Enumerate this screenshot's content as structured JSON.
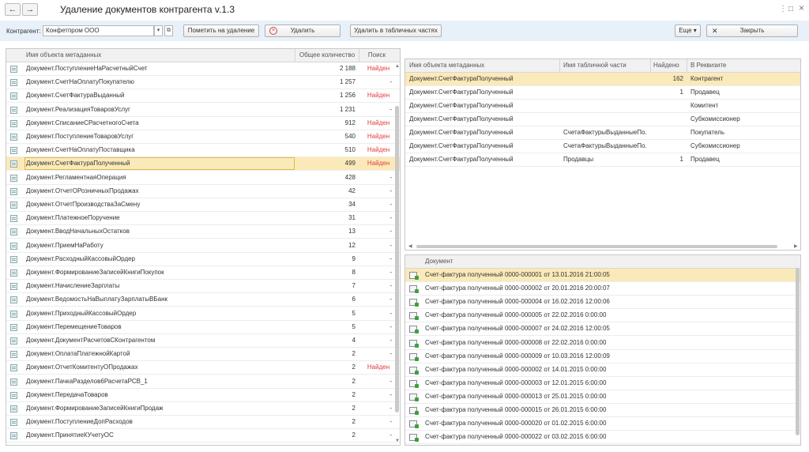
{
  "window": {
    "title": "Удаление документов контрагента v.1.3",
    "back_icon": "←",
    "forward_icon": "→",
    "menu_icon": "⋮",
    "minimize_icon": "□",
    "close_icon": "×"
  },
  "toolbar": {
    "counterparty_label": "Контрагент:",
    "counterparty_value": "Конфетпром ООО",
    "dropdown_icon": "▾",
    "open_icon": "⧉",
    "mark_delete_label": "Пометить на удаление",
    "delete_label": "Удалить",
    "delete_icon": "×",
    "delete_tables_label": "Удалить в табличных частях",
    "more_label": "Еще ▾",
    "close_label": "Закрыть",
    "close_icon": "✕"
  },
  "left_table": {
    "headers": [
      "Имя объекта метаданных",
      "Общее количество",
      "Поиск"
    ],
    "rows": [
      {
        "name": "Документ.ПоступлениеНаРасчетныйСчет",
        "count": "2 188",
        "search": "Найден"
      },
      {
        "name": "Документ.СчетНаОплатуПокупателю",
        "count": "1 257",
        "search": "-"
      },
      {
        "name": "Документ.СчетФактураВыданный",
        "count": "1 256",
        "search": "Найден"
      },
      {
        "name": "Документ.РеализацияТоваровУслуг",
        "count": "1 231",
        "search": "-"
      },
      {
        "name": "Документ.СписаниеСРасчетногоСчета",
        "count": "912",
        "search": "Найден"
      },
      {
        "name": "Документ.ПоступлениеТоваровУслуг",
        "count": "540",
        "search": "Найден"
      },
      {
        "name": "Документ.СчетНаОплатуПоставщика",
        "count": "510",
        "search": "Найден"
      },
      {
        "name": "Документ.СчетФактураПолученный",
        "count": "499",
        "search": "Найден"
      },
      {
        "name": "Документ.РегламентнаяОперация",
        "count": "428",
        "search": "-"
      },
      {
        "name": "Документ.ОтчетОРозничныхПродажах",
        "count": "42",
        "search": "-"
      },
      {
        "name": "Документ.ОтчетПроизводстваЗаСмену",
        "count": "34",
        "search": "-"
      },
      {
        "name": "Документ.ПлатежноеПоручение",
        "count": "31",
        "search": "-"
      },
      {
        "name": "Документ.ВводНачальныхОстатков",
        "count": "13",
        "search": "-"
      },
      {
        "name": "Документ.ПриемНаРаботу",
        "count": "12",
        "search": "-"
      },
      {
        "name": "Документ.РасходныйКассовыйОрдер",
        "count": "9",
        "search": "-"
      },
      {
        "name": "Документ.ФормированиеЗаписейКнигиПокупок",
        "count": "8",
        "search": "-"
      },
      {
        "name": "Документ.НачислениеЗарплаты",
        "count": "7",
        "search": "-"
      },
      {
        "name": "Документ.ВедомостьНаВыплатуЗарплатыВБанк",
        "count": "6",
        "search": "-"
      },
      {
        "name": "Документ.ПриходныйКассовыйОрдер",
        "count": "5",
        "search": "-"
      },
      {
        "name": "Документ.ПеремещениеТоваров",
        "count": "5",
        "search": "-"
      },
      {
        "name": "Документ.ДокументРасчетовСКонтрагентом",
        "count": "4",
        "search": "-"
      },
      {
        "name": "Документ.ОплатаПлатежнойКартой",
        "count": "2",
        "search": "-"
      },
      {
        "name": "Документ.ОтчетКомитентуОПродажах",
        "count": "2",
        "search": "Найден"
      },
      {
        "name": "Документ.ПачкаРазделов6РасчетаРСВ_1",
        "count": "2",
        "search": "-"
      },
      {
        "name": "Документ.ПередачаТоваров",
        "count": "2",
        "search": "-"
      },
      {
        "name": "Документ.ФормированиеЗаписейКнигиПродаж",
        "count": "2",
        "search": "-"
      },
      {
        "name": "Документ.ПоступлениеДопРасходов",
        "count": "2",
        "search": "-"
      },
      {
        "name": "Документ.ПринятиеКУчетуОС",
        "count": "2",
        "search": "-"
      }
    ]
  },
  "right_top_table": {
    "headers": [
      "Имя объекта метаданных",
      "Имя табличной части",
      "Найдено",
      "В Реквизите"
    ],
    "rows": [
      {
        "name": "Документ.СчетФактураПолученный",
        "table_part": "",
        "found": "162",
        "attribute": "Контрагент"
      },
      {
        "name": "Документ.СчетФактураПолученный",
        "table_part": "",
        "found": "1",
        "attribute": "Продавец"
      },
      {
        "name": "Документ.СчетФактураПолученный",
        "table_part": "",
        "found": "",
        "attribute": "Комитент"
      },
      {
        "name": "Документ.СчетФактураПолученный",
        "table_part": "",
        "found": "",
        "attribute": "Субкомиссионер"
      },
      {
        "name": "Документ.СчетФактураПолученный",
        "table_part": "СчетаФактурыВыданныеПо...",
        "found": "",
        "attribute": "Покупатель"
      },
      {
        "name": "Документ.СчетФактураПолученный",
        "table_part": "СчетаФактурыВыданныеПо...",
        "found": "",
        "attribute": "Субкомиссионер"
      },
      {
        "name": "Документ.СчетФактураПолученный",
        "table_part": "Продавцы",
        "found": "1",
        "attribute": "Продавец"
      }
    ]
  },
  "right_bottom_table": {
    "header": "Документ",
    "rows": [
      "Счет-фактура полученный 0000-000001 от 13.01.2016 21:00:05",
      "Счет-фактура полученный 0000-000002 от 20.01.2016 20:00:07",
      "Счет-фактура полученный 0000-000004 от 16.02.2016 12:00:06",
      "Счет-фактура полученный 0000-000005 от 22.02.2016 0:00:00",
      "Счет-фактура полученный 0000-000007 от 24.02.2016 12:00:05",
      "Счет-фактура полученный 0000-000008 от 22.02.2016 0:00:00",
      "Счет-фактура полученный 0000-000009 от 10.03.2016 12:00:09",
      "Счет-фактура полученный 0000-000002 от 14.01.2015 0:00:00",
      "Счет-фактура полученный 0000-000003 от 12.01.2015 6:00:00",
      "Счет-фактура полученный 0000-000013 от 25.01.2015 0:00:00",
      "Счет-фактура полученный 0000-000015 от 26.01.2015 6:00:00",
      "Счет-фактура полученный 0000-000020 от 01.02.2015 6:00:00",
      "Счет-фактура полученный 0000-000022 от 03.02.2015 6:00:00"
    ]
  },
  "colors": {
    "toolbar_bg": "#e8f1f9",
    "selected_row": "#fbeab9",
    "found_text": "#e23b3b"
  }
}
